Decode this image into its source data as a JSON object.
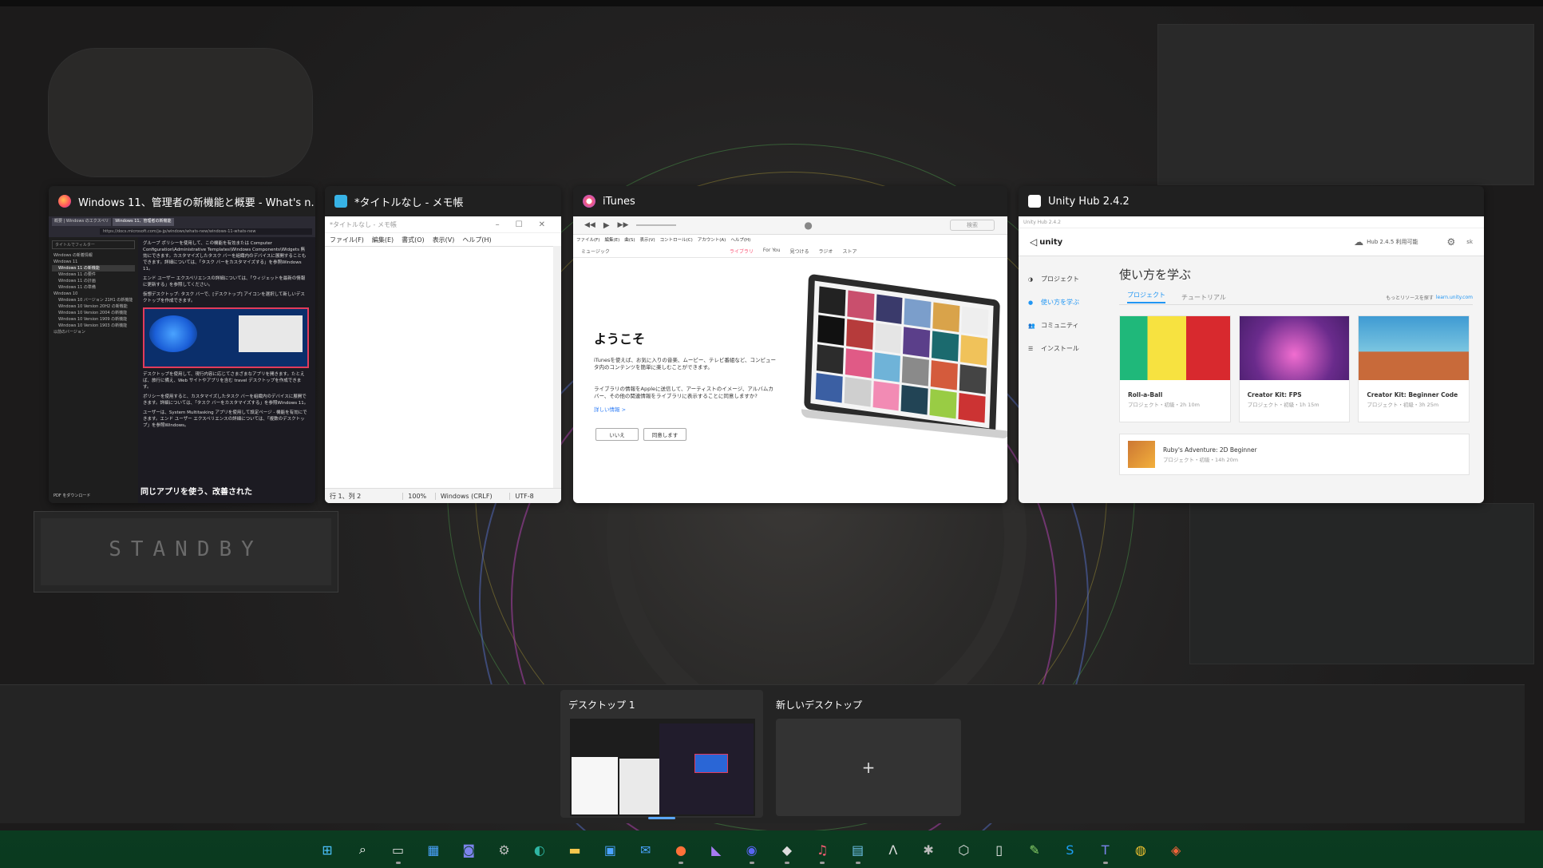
{
  "windows": [
    {
      "title": "Windows 11、管理者の新機能と概要 - What's n...",
      "doc": {
        "tab1": "概要 | Windows のエクスペリ",
        "tab2": "Windows 11、管理者の新機能",
        "url": "https://docs.microsoft.com/ja-jp/windows/whats-new/windows-11-whats-new",
        "filter": "タイトルでフィルター",
        "nav": [
          "Windows の新着情報",
          "Windows 11",
          "Windows 11 の新機能",
          "Windows 11 の要件",
          "Windows 11 の計画",
          "Windows 11 の準備",
          "Windows 10",
          "Windows 10 バージョン 21H1 の新機能",
          "Windows 10 Version 20H2 の新機能",
          "Windows 10 Version 2004 の新機能",
          "Windows 10 Version 1909 の新機能",
          "Windows 10 Version 1903 の新機能",
          "以前のバージョン"
        ],
        "pdf": "PDF をダウンロード",
        "p1": "グループ ポリシーを使用して、この機能を有効または Computer Configuration\\Administrative Templates\\Windows Components\\Widgets 無効にできます。カスタマイズしたタスク バーを組織内のデバイスに展開することもできます。詳細については、「タスク バーをカスタマイズする」を参照Windows 11。",
        "p2": "エンド ユーザー エクスペリエンスの詳細については、「ウィジェットを最新の情報に更新する」を参照してください。",
        "p3": "仮想デスクトップ: タスク バーで、[デスクトップ] アイコンを選択して新しいデスクトップを作成できます。",
        "p4": "デスクトップを使用して、現行内容に応じてさまざまなアプリを開きます。たとえば、旅行に備え、Web サイトやアプリを含む travel デスクトップを作成できます。",
        "p5": "ポリシーを使用すると、カスタマイズしたタスク バーを組織内のデバイスに展開できます。詳細については、「タスク バーをカスタマイズする」を参照Windows 11。",
        "p6": "ユーザーは、System Multitasking アプリを使用して設定ページ - 機能を有効にできます。エンド ユーザー エクスペリエンスの詳細については、「複数のデスクトップ」を参照Windows。",
        "heading": "同じアプリを使う、改善された"
      }
    },
    {
      "title": "*タイトルなし - メモ帳",
      "doc": {
        "inner_title": "*タイトルなし - メモ帳",
        "menu": [
          "ファイル(F)",
          "編集(E)",
          "書式(O)",
          "表示(V)",
          "ヘルプ(H)"
        ],
        "status": [
          "行 1、列 2",
          "100%",
          "Windows (CRLF)",
          "UTF-8"
        ]
      }
    },
    {
      "title": "iTunes",
      "doc": {
        "menu": [
          "ファイル(F)",
          "編集(E)",
          "曲(S)",
          "表示(V)",
          "コントロール(C)",
          "アカウント(A)",
          "ヘルプ(H)"
        ],
        "library": "ミュージック",
        "search": "検索",
        "tabs": [
          "ライブラリ",
          "For You",
          "見つける",
          "ラジオ",
          "ストア"
        ],
        "welcome": "ようこそ",
        "p1": "iTunesを使えば、お気に入りの音楽、ムービー、テレビ番組など、コンピュータ内のコンテンツを簡単に楽しむことができます。",
        "p2": "ライブラリの情報をAppleに送信して、アーティストのイメージ、アルバムカバー、その他の関連情報をライブラリに表示することに同意しますか?",
        "link": "詳しい情報 >",
        "no": "いいえ",
        "agree": "同意します"
      }
    },
    {
      "title": "Unity Hub 2.4.2",
      "doc": {
        "inner_title": "Unity Hub 2.4.2",
        "brand": "unity",
        "update": "Hub 2.4.5 利用可能",
        "user": "sk",
        "nav": [
          "プロジェクト",
          "使い方を学ぶ",
          "コミュニティ",
          "インストール"
        ],
        "heading": "使い方を学ぶ",
        "tabs": [
          "プロジェクト",
          "チュートリアル"
        ],
        "more": "もっとリソースを探す",
        "more_link": "learn.unity.com",
        "cards": [
          {
            "name": "Roll-a-Ball",
            "meta": "プロジェクト・初級・2h 10m"
          },
          {
            "name": "Creator Kit: FPS",
            "meta": "プロジェクト・初級・1h 15m"
          },
          {
            "name": "Creator Kit: Beginner Code",
            "meta": "プロジェクト・初級・3h 25m"
          }
        ],
        "wide_card": {
          "name": "Ruby's Adventure: 2D Beginner",
          "meta": "プロジェクト・初級・14h 20m"
        }
      }
    }
  ],
  "standby_label": "STANDBY",
  "desktops": {
    "current": "デスクトップ 1",
    "new": "新しいデスクトップ",
    "plus": "+"
  },
  "taskbar": [
    "windows-start",
    "search",
    "task-view",
    "widgets",
    "teams-chat",
    "settings",
    "edge",
    "file-explorer",
    "microsoft-store",
    "mail",
    "firefox",
    "visual-studio",
    "discord",
    "unity-hub",
    "itunes",
    "notepad",
    "app-a",
    "app-b",
    "app-c",
    "document",
    "notepad-plus",
    "skype",
    "teams",
    "chrome",
    "app-d"
  ]
}
